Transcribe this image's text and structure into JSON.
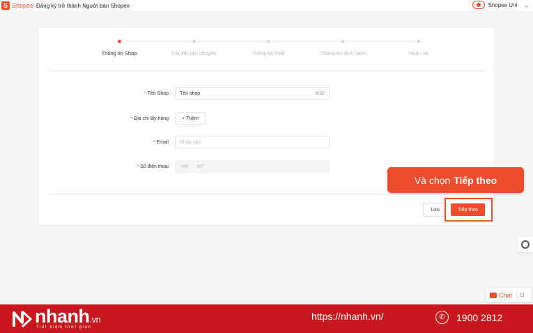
{
  "topbar": {
    "logo_glyph": "S",
    "brand": "Shopee",
    "title": "Đăng ký trở thành Người bán Shopee",
    "user_name": "Shopee Uni",
    "chevron": "⌄"
  },
  "stepper": {
    "steps": [
      {
        "label": "Thông tin Shop",
        "active": true
      },
      {
        "label": "Cài đặt vận chuyển",
        "active": false
      },
      {
        "label": "Thông tin thuế",
        "active": false
      },
      {
        "label": "Thông tin định danh",
        "active": false
      },
      {
        "label": "Hoàn tất",
        "active": false
      }
    ]
  },
  "form": {
    "shop_name": {
      "label": "Tên Shop",
      "value": "Tên shop",
      "counter": "8/30"
    },
    "pickup_address": {
      "label": "Địa chỉ lấy hàng",
      "button": "+ Thêm"
    },
    "email": {
      "label": "Email",
      "placeholder": "Nhập vào"
    },
    "phone": {
      "label": "Số điện thoại",
      "prefix": "+84",
      "value": "367"
    }
  },
  "actions": {
    "save": "Lưu",
    "next": "Tiếp theo"
  },
  "callout": {
    "prefix": "Và chọn",
    "bold": "Tiếp theo"
  },
  "chat": {
    "label": "Chat",
    "minimize": "⊡"
  },
  "footer": {
    "brand": "nhanh",
    "brand_suffix": ".vn",
    "tagline": "Tiết kiệm thời gian",
    "url": "https://nhanh.vn/",
    "phone": "1900 2812",
    "phone_glyph": "✆"
  },
  "colors": {
    "accent": "#ee4d2d",
    "footer_bg": "#c8181e"
  }
}
